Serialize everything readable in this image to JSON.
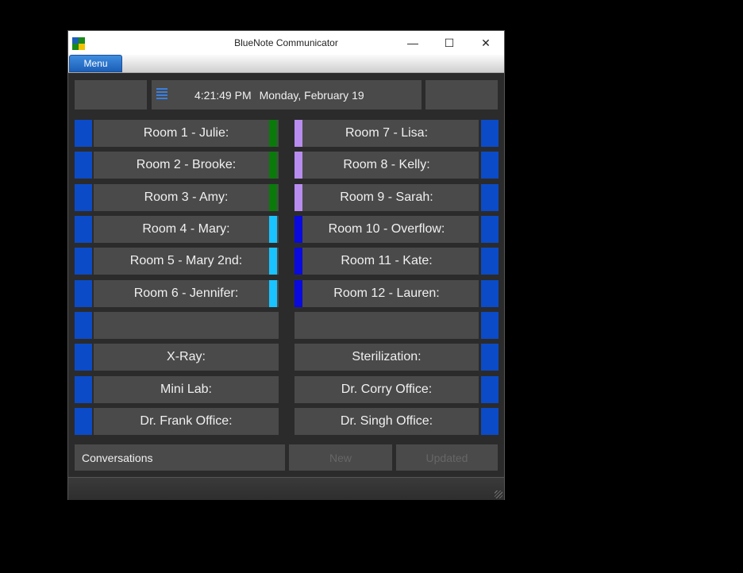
{
  "window": {
    "title": "BlueNote Communicator"
  },
  "controls": {
    "minimize": "—",
    "maximize": "☐",
    "close": "✕"
  },
  "menu": {
    "label": "Menu"
  },
  "header": {
    "time": "4:21:49 PM",
    "date": "Monday, February 19"
  },
  "left_rooms": [
    {
      "label": "Room 1 - Julie:",
      "indicator": "#0a7a0a"
    },
    {
      "label": "Room 2 - Brooke:",
      "indicator": "#0a7a0a"
    },
    {
      "label": "Room 3 - Amy:",
      "indicator": "#0a7a0a"
    },
    {
      "label": "Room 4 - Mary:",
      "indicator": "#19c3ff"
    },
    {
      "label": "Room 5 - Mary 2nd:",
      "indicator": "#19c3ff"
    },
    {
      "label": "Room 6 - Jennifer:",
      "indicator": "#19c3ff"
    },
    {
      "label": "",
      "indicator": ""
    },
    {
      "label": "X-Ray:",
      "indicator": ""
    },
    {
      "label": "Mini Lab:",
      "indicator": ""
    },
    {
      "label": "Dr. Frank Office:",
      "indicator": ""
    }
  ],
  "right_rooms": [
    {
      "label": "Room 7 - Lisa:",
      "indicator": "#b98cf0"
    },
    {
      "label": "Room 8 - Kelly:",
      "indicator": "#b98cf0"
    },
    {
      "label": "Room 9 - Sarah:",
      "indicator": "#b98cf0"
    },
    {
      "label": "Room 10 - Overflow:",
      "indicator": "#0a0adf"
    },
    {
      "label": "Room 11 - Kate:",
      "indicator": "#0a0adf"
    },
    {
      "label": "Room 12 - Lauren:",
      "indicator": "#0a0adf"
    },
    {
      "label": "",
      "indicator": ""
    },
    {
      "label": "Sterilization:",
      "indicator": ""
    },
    {
      "label": "Dr. Corry Office:",
      "indicator": ""
    },
    {
      "label": "Dr. Singh Office:",
      "indicator": ""
    }
  ],
  "footer": {
    "conversations": "Conversations",
    "new": "New",
    "updated": "Updated"
  },
  "colors": {
    "stripe": "#0b4bc7",
    "cell": "#4a4a4a",
    "accent": "#1c5fb8"
  }
}
